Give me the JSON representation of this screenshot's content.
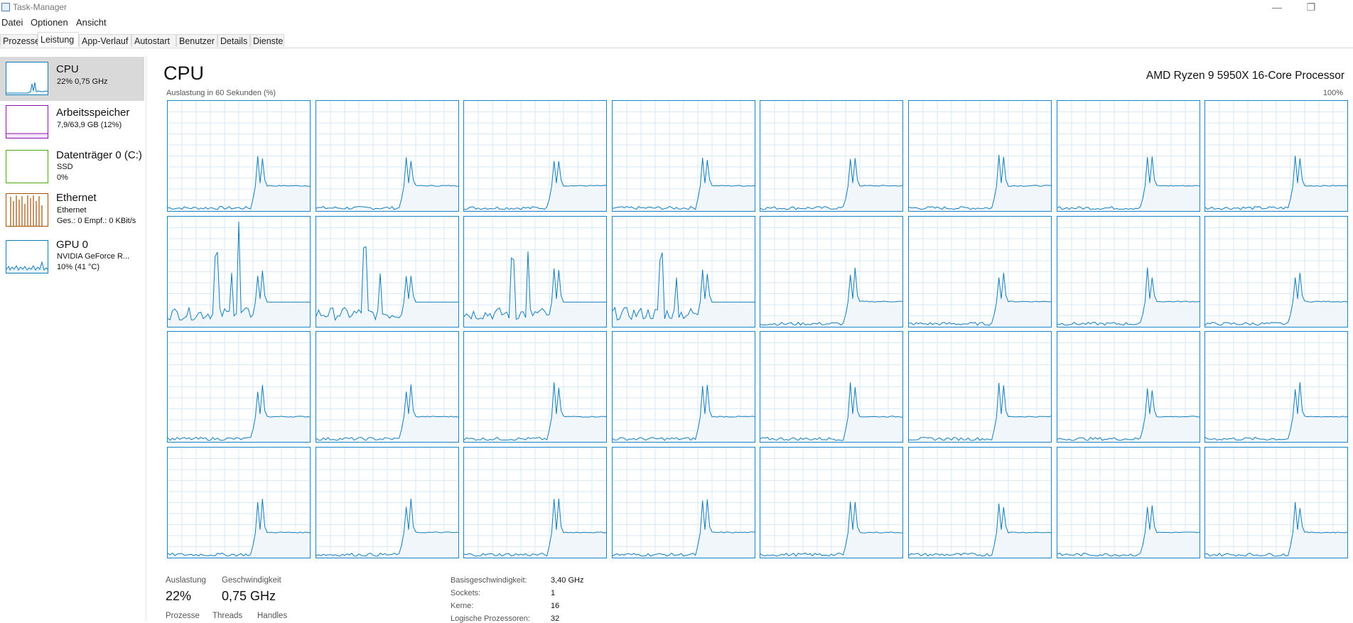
{
  "window": {
    "title": "Task-Manager",
    "minimize": "—",
    "restore": "❐"
  },
  "menu": [
    "Datei",
    "Optionen",
    "Ansicht"
  ],
  "tabs": [
    "Prozesse",
    "Leistung",
    "App-Verlauf",
    "Autostart",
    "Benutzer",
    "Details",
    "Dienste"
  ],
  "active_tab": "Leistung",
  "sidebar": {
    "items": [
      {
        "name": "CPU",
        "line1": "22% 0,75 GHz",
        "line2": "",
        "color": "#117dbb"
      },
      {
        "name": "Arbeitsspeicher",
        "line1": "7,9/63,9 GB (12%)",
        "line2": "",
        "color": "#8b12ae"
      },
      {
        "name": "Datenträger 0 (C:)",
        "line1": "SSD",
        "line2": "0%",
        "color": "#4da60c"
      },
      {
        "name": "Ethernet",
        "line1": "Ethernet",
        "line2": "Ges.: 0 Empf.: 0 KBit/s",
        "color": "#a74f01"
      },
      {
        "name": "GPU 0",
        "line1": "NVIDIA GeForce R...",
        "line2": "10% (41 °C)",
        "color": "#117dbb"
      }
    ]
  },
  "main": {
    "title": "CPU",
    "model": "AMD Ryzen 9 5950X 16-Core Processor",
    "graph_caption": "Auslastung in 60 Sekunden (%)",
    "graph_max": "100%",
    "core_color": "#117dbb",
    "core_count": 32
  },
  "stats": {
    "auslastung_label": "Auslastung",
    "auslastung_value": "22%",
    "geschwindigkeit_label": "Geschwindigkeit",
    "geschwindigkeit_value": "0,75 GHz",
    "prozesse_label": "Prozesse",
    "threads_label": "Threads",
    "handles_label": "Handles"
  },
  "specs": [
    {
      "label": "Basisgeschwindigkeit:",
      "value": "3,40 GHz"
    },
    {
      "label": "Sockets:",
      "value": "1"
    },
    {
      "label": "Kerne:",
      "value": "16"
    },
    {
      "label": "Logische Prozessoren:",
      "value": "32"
    }
  ]
}
